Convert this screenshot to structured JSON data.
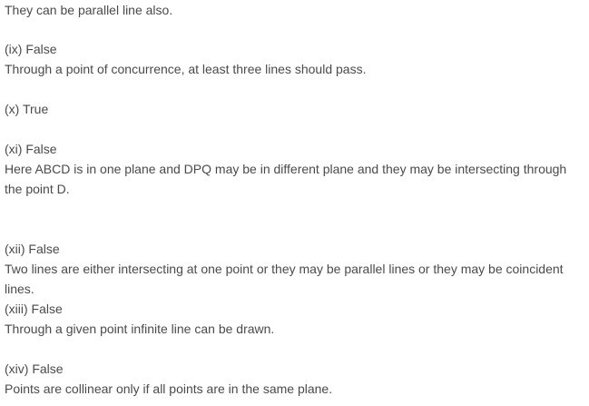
{
  "lines": [
    "They can be parallel line also.",
    "(ix) False",
    "Through a point of concurrence, at least three lines should pass.",
    "(x) True",
    "(xi) False",
    "Here ABCD is in one plane and DPQ may be in different plane and they may be intersecting through",
    "the point D.",
    "(xii) False",
    "Two lines are either intersecting at one point or they may be parallel lines or they may be coincident",
    "lines.",
    "(xiii) False",
    "Through a given point infinite line can be drawn.",
    "(xiv) False",
    "Points are collinear only if all points are in the same plane."
  ]
}
